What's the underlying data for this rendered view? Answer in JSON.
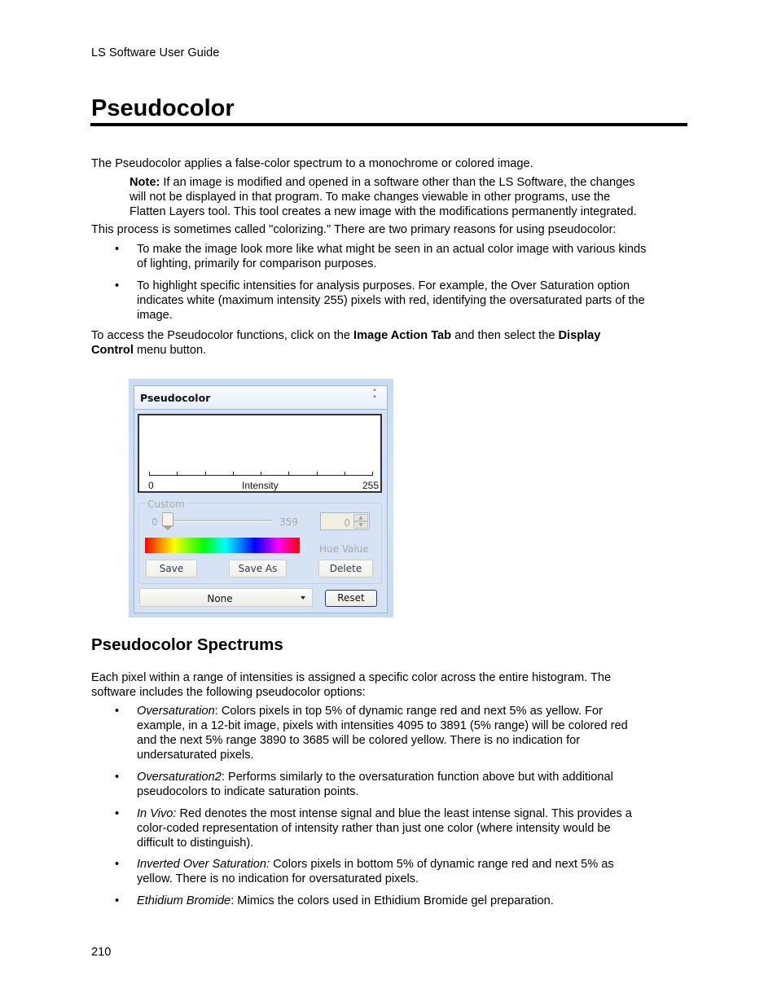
{
  "running_head": "LS Software User Guide",
  "title": "Pseudocolor",
  "intro": "The Pseudocolor applies a false-color spectrum to a monochrome or colored image.",
  "note": {
    "label": "Note:",
    "text_line1": " If an image is modified and opened in a software other than the LS Software, the changes",
    "text_line2": "will not be displayed in that program. To make changes viewable in other programs, use the",
    "text_line3": "Flatten Layers tool. This tool creates a new image with the modifications permanently integrated."
  },
  "reasons_intro": "This process is sometimes called \"colorizing.\" There are two primary reasons for using pseudocolor:",
  "reasons": [
    {
      "line1": "To make the image look more like what might be seen in an actual color image with various kinds",
      "line2": "of lighting, primarily for comparison purposes."
    },
    {
      "line1": "To highlight specific intensities for analysis purposes. For example, the Over Saturation option",
      "line2": "indicates white (maximum intensity 255) pixels with red, identifying the oversaturated parts of the",
      "line3": "image."
    }
  ],
  "access": {
    "pre": "To access the Pseudocolor functions, click on the ",
    "bold1": "Image Action Tab",
    "mid": " and then select the ",
    "bold2a": "Display",
    "bold2b": "Control",
    "post": " menu button."
  },
  "panel": {
    "title": "Pseudocolor",
    "collapse_glyph": "˄˄",
    "histogram": {
      "x_min_label": "0",
      "x_label": "Intensity",
      "x_max_label": "255"
    },
    "custom_group_label": "Custom",
    "slider": {
      "min_label": "0",
      "max_label": "359",
      "value": 0,
      "max": 359
    },
    "hue_value": "0",
    "hue_label": "Hue Value",
    "buttons": {
      "save": "Save",
      "save_as": "Save As",
      "delete": "Delete",
      "reset": "Reset"
    },
    "preset_selected": "None"
  },
  "section2": {
    "heading": "Pseudocolor Spectrums",
    "intro_line1": "Each pixel within a range of intensities is assigned a specific color across the entire histogram. The",
    "intro_line2": "software includes the following pseudocolor options:",
    "options": [
      {
        "name": "Oversaturation",
        "sep": ":",
        "line1": " Colors pixels in top 5% of dynamic range red and next 5% as yellow. For",
        "line2": "example, in a 12-bit image, pixels with intensities 4095 to 3891 (5% range) will be colored red",
        "line3": "and the next 5% range 3890 to 3685 will be colored yellow. There is no indication for",
        "line4": "undersaturated pixels."
      },
      {
        "name": "Oversaturation2",
        "sep": ":",
        "line1": " Performs similarly to the oversaturation function above but with additional",
        "line2": "pseudocolors to indicate saturation points."
      },
      {
        "name": "In Vivo:",
        "sep": "",
        "line1": " Red denotes the most intense signal and blue the least intense signal. This provides a",
        "line2": "color-coded representation of intensity rather than just one color (where intensity would be",
        "line3": "difficult to distinguish)."
      },
      {
        "name": "Inverted Over Saturation:",
        "sep": "",
        "line1": " Colors pixels in bottom 5% of dynamic range red and next 5% as",
        "line2": "yellow. There is no indication for oversaturated pixels."
      },
      {
        "name": "Ethidium Bromide",
        "sep": ":",
        "line1": " Mimics the colors used in Ethidium Bromide gel preparation."
      }
    ]
  },
  "page_number": "210",
  "bullet_glyph": "•"
}
